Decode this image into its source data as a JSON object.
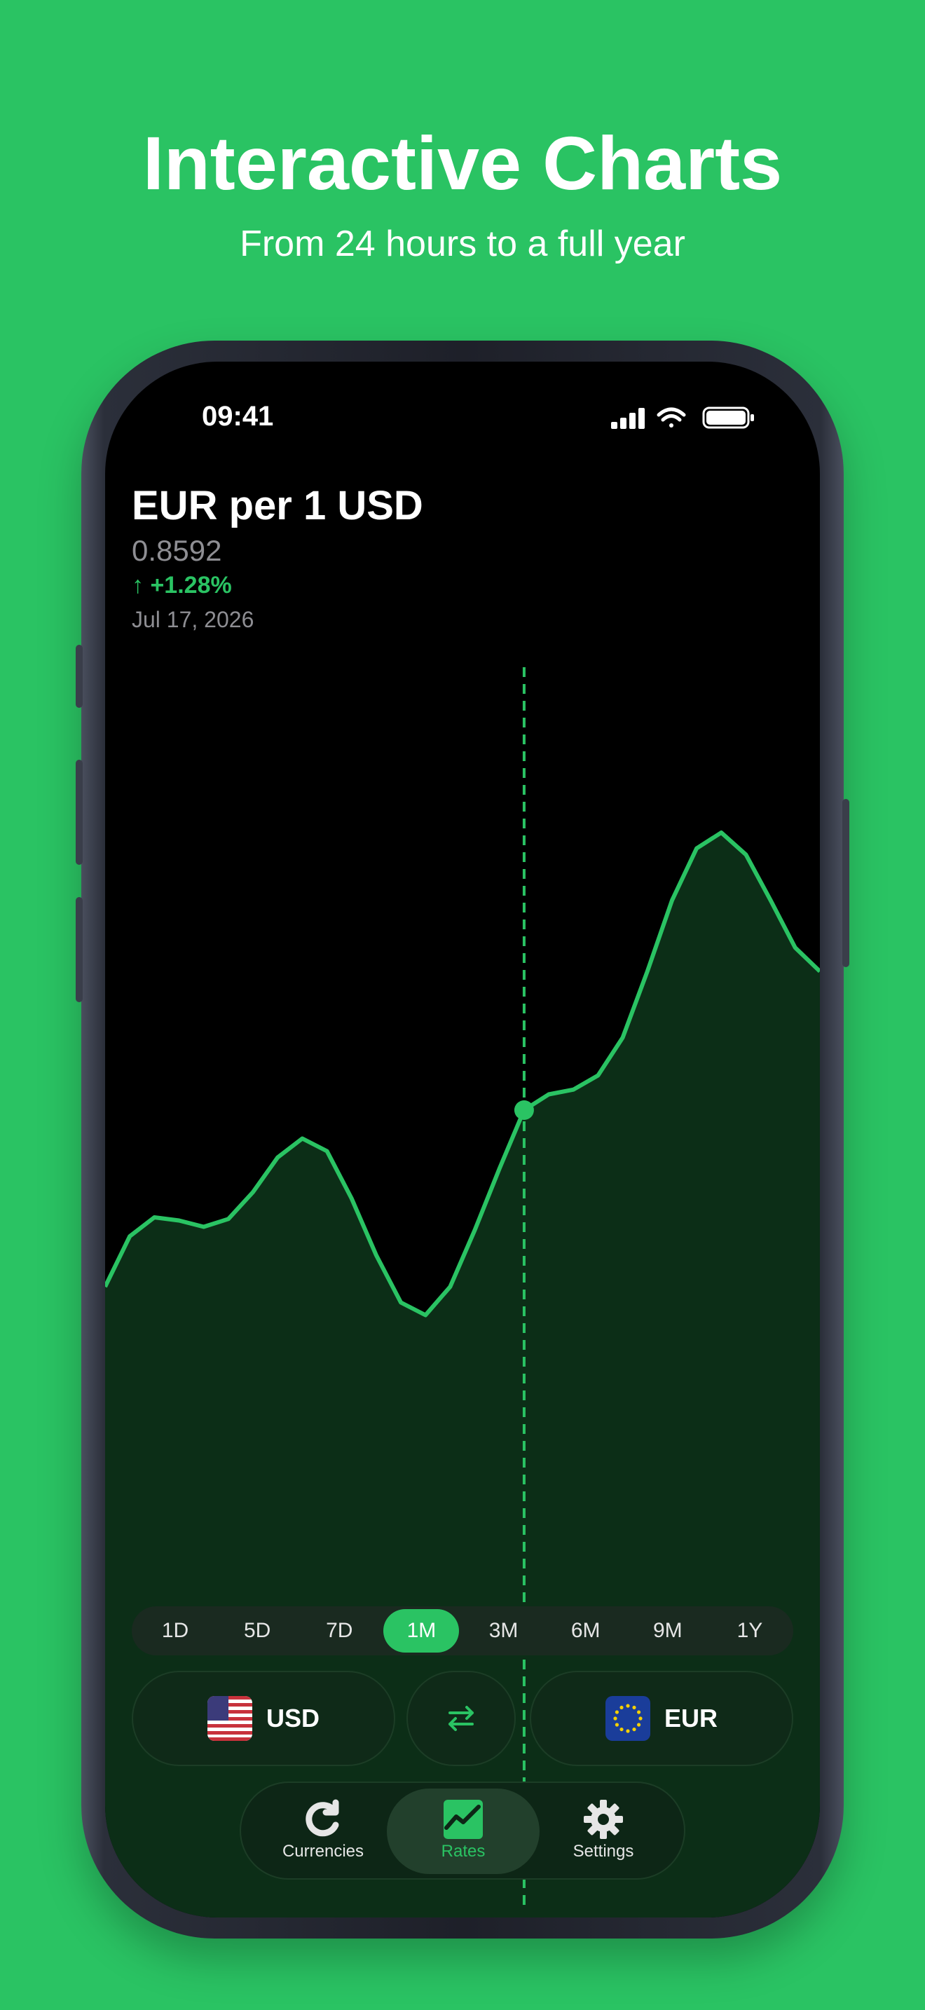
{
  "marketing": {
    "headline": "Interactive Charts",
    "subhead": "From 24 hours to a full year"
  },
  "status_bar": {
    "time": "09:41"
  },
  "rate": {
    "title": "EUR per 1 USD",
    "value": "0.8592",
    "change": "↑ +1.28%",
    "date": "Jul 17, 2026"
  },
  "range": {
    "options": [
      "1D",
      "5D",
      "7D",
      "1M",
      "3M",
      "6M",
      "9M",
      "1Y"
    ],
    "selected": "1M"
  },
  "pair": {
    "from": {
      "code": "USD",
      "flag": "us-flag"
    },
    "to": {
      "code": "EUR",
      "flag": "eu-flag"
    },
    "swap_icon": "swap-arrows-icon"
  },
  "tabs": [
    {
      "label": "Currencies",
      "icon": "refresh-icon",
      "active": false
    },
    {
      "label": "Rates",
      "icon": "chart-icon",
      "active": true
    },
    {
      "label": "Settings",
      "icon": "gear-icon",
      "active": false
    }
  ],
  "colors": {
    "accent": "#2ac363",
    "background": "#2ac363",
    "screen": "#000000",
    "chart_fill": "#0c2e17"
  },
  "chart_data": {
    "type": "area",
    "series": [
      {
        "values": [
          0.848,
          0.8512,
          0.8524,
          0.8522,
          0.8518,
          0.8523,
          0.854,
          0.8562,
          0.8574,
          0.8566,
          0.8536,
          0.85,
          0.847,
          0.8462,
          0.848,
          0.8516,
          0.8555,
          0.8592,
          0.8602,
          0.8605,
          0.8614,
          0.8638,
          0.868,
          0.8725,
          0.8758,
          0.8768,
          0.8754,
          0.8725,
          0.8695,
          0.868
        ]
      }
    ],
    "selected_index": 17,
    "ylim": [
      0.84,
      0.88
    ],
    "grid": false
  }
}
